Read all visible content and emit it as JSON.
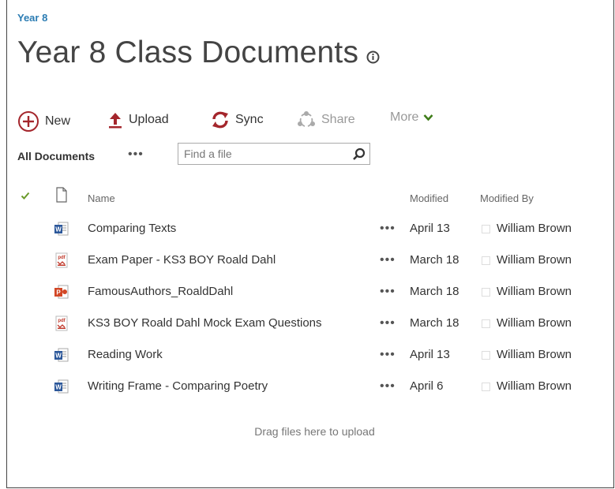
{
  "breadcrumb": "Year 8",
  "title": "Year 8 Class Documents",
  "toolbar": {
    "new_label": "New",
    "upload_label": "Upload",
    "sync_label": "Sync",
    "share_label": "Share",
    "more_label": "More"
  },
  "views": {
    "current": "All Documents",
    "overflow": "•••"
  },
  "search": {
    "placeholder": "Find a file",
    "value": ""
  },
  "columns": {
    "type": "",
    "name": "Name",
    "modified": "Modified",
    "modified_by": "Modified By"
  },
  "files": [
    {
      "type": "word",
      "name": "Comparing Texts",
      "modified": "April 13",
      "modified_by": "William Brown",
      "menu": "•••"
    },
    {
      "type": "pdf",
      "name": "Exam Paper - KS3 BOY Roald Dahl",
      "modified": "March 18",
      "modified_by": "William Brown",
      "menu": "•••"
    },
    {
      "type": "powerpoint",
      "name": "FamousAuthors_RoaldDahl",
      "modified": "March 18",
      "modified_by": "William Brown",
      "menu": "•••"
    },
    {
      "type": "pdf",
      "name": "KS3 BOY Roald Dahl Mock Exam Questions",
      "modified": "March 18",
      "modified_by": "William Brown",
      "menu": "•••"
    },
    {
      "type": "word",
      "name": "Reading Work",
      "modified": "April 13",
      "modified_by": "William Brown",
      "menu": "•••"
    },
    {
      "type": "word",
      "name": "Writing Frame - Comparing Poetry",
      "modified": "April 6",
      "modified_by": "William Brown",
      "menu": "•••"
    }
  ],
  "drop_hint": "Drag files here to upload",
  "colors": {
    "accent_red": "#a4262c",
    "link_blue": "#2b7cb3",
    "check_green": "#6a9a2a",
    "more_chevron_green": "#3f7d1a",
    "word_blue": "#2b579a",
    "pdf_red": "#c0392b",
    "ppt_red": "#d24726"
  }
}
